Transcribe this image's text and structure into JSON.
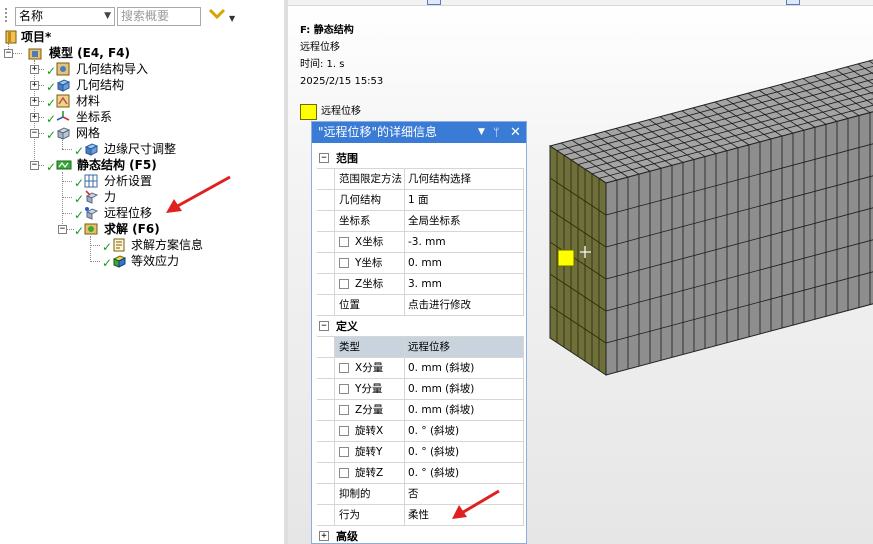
{
  "toolbar": {
    "name_select": "名称",
    "search_placeholder": "搜索概要"
  },
  "tree": {
    "items": [
      {
        "label": "项目*",
        "bold": true
      },
      {
        "label": "模型 (E4, F4)",
        "bold": true
      },
      {
        "label": "几何结构导入"
      },
      {
        "label": "几何结构"
      },
      {
        "label": "材料"
      },
      {
        "label": "坐标系"
      },
      {
        "label": "网格"
      },
      {
        "label": "边缘尺寸调整"
      },
      {
        "label": "静态结构 (F5)",
        "bold": true
      },
      {
        "label": "分析设置"
      },
      {
        "label": "力"
      },
      {
        "label": "远程位移"
      },
      {
        "label": "求解 (F6)",
        "bold": true
      },
      {
        "label": "求解方案信息"
      },
      {
        "label": "等效应力"
      }
    ]
  },
  "viewport": {
    "analysis": "F: 静态结构",
    "object": "远程位移",
    "time": "时间: 1. s",
    "date": "2025/2/15 15:53",
    "legend_label": "远程位移",
    "legend_color": "#ffff00"
  },
  "details": {
    "title": "\"远程位移\"的详细信息",
    "sections": {
      "scope": "范围",
      "definition": "定义",
      "advanced": "高级"
    },
    "rows": {
      "scoping_method_k": "范围限定方法",
      "scoping_method_v": "几何结构选择",
      "geometry_k": "几何结构",
      "geometry_v": "1 面",
      "coord_k": "坐标系",
      "coord_v": "全局坐标系",
      "xc_k": "X坐标",
      "xc_v": "-3. mm",
      "yc_k": "Y坐标",
      "yc_v": "0. mm",
      "zc_k": "Z坐标",
      "zc_v": "3. mm",
      "loc_k": "位置",
      "loc_v": "点击进行修改",
      "type_k": "类型",
      "type_v": "远程位移",
      "xd_k": "X分量",
      "xd_v": "0. mm  (斜坡)",
      "yd_k": "Y分量",
      "yd_v": "0. mm  (斜坡)",
      "zd_k": "Z分量",
      "zd_v": "0. mm  (斜坡)",
      "rx_k": "旋转X",
      "rx_v": "0. °  (斜坡)",
      "ry_k": "旋转Y",
      "ry_v": "0. °  (斜坡)",
      "rz_k": "旋转Z",
      "rz_v": "0. °  (斜坡)",
      "sup_k": "抑制的",
      "sup_v": "否",
      "beh_k": "行为",
      "beh_v": "柔性"
    }
  },
  "colors": {
    "accent": "#3a7bd5",
    "check": "#1a9a1a",
    "arrow": "#e02020",
    "mesh_face": "#9b9b9b",
    "selected_face": "#6f6f3a"
  }
}
